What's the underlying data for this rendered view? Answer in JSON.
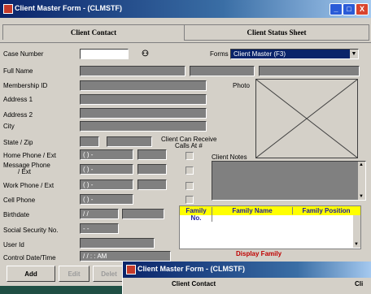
{
  "window": {
    "title": "Client Master Form - (CLMSTF)",
    "minimize": "_",
    "maximize": "□",
    "close": "X"
  },
  "tabs": [
    "Client Contact",
    "Client Status Sheet"
  ],
  "labels": {
    "case_number": "Case Number",
    "full_name": "Full Name",
    "membership_id": "Membership ID",
    "address1": "Address 1",
    "address2": "Address 2",
    "city": "City",
    "state_zip": "State / Zip",
    "home_phone": "Home Phone / Ext",
    "message_phone_1": "Message Phone",
    "message_phone_2": "/ Ext",
    "work_phone": "Work Phone / Ext",
    "cell_phone": "Cell Phone",
    "birthdate": "Birthdate",
    "ssn": "Social Security No.",
    "user_id": "User Id",
    "control_datetime": "Control Date/Time",
    "forms": "Forms",
    "photo": "Photo",
    "calls_1": "Client Can Receive",
    "calls_2": "Calls At #",
    "client_notes": "Client Notes"
  },
  "values": {
    "home_phone": "(  )  -",
    "message_phone": "(  )  -",
    "work_phone": "(  )  -",
    "cell_phone": "(  )  -",
    "birthdate": "/ /",
    "ssn": "-  -",
    "control_datetime": "/ /    :  :  AM"
  },
  "forms_select": "Client Master (F3)",
  "family_table": {
    "columns": [
      "Family No.",
      "Family Name",
      "Family Position"
    ],
    "display_label": "Display Family"
  },
  "buttons": {
    "add": "Add",
    "edit": "Edit",
    "delete": "Delet"
  },
  "second_window": {
    "title": "Client Master Form - (CLMSTF)",
    "tab1": "Client Contact",
    "tab2": "Cli"
  }
}
